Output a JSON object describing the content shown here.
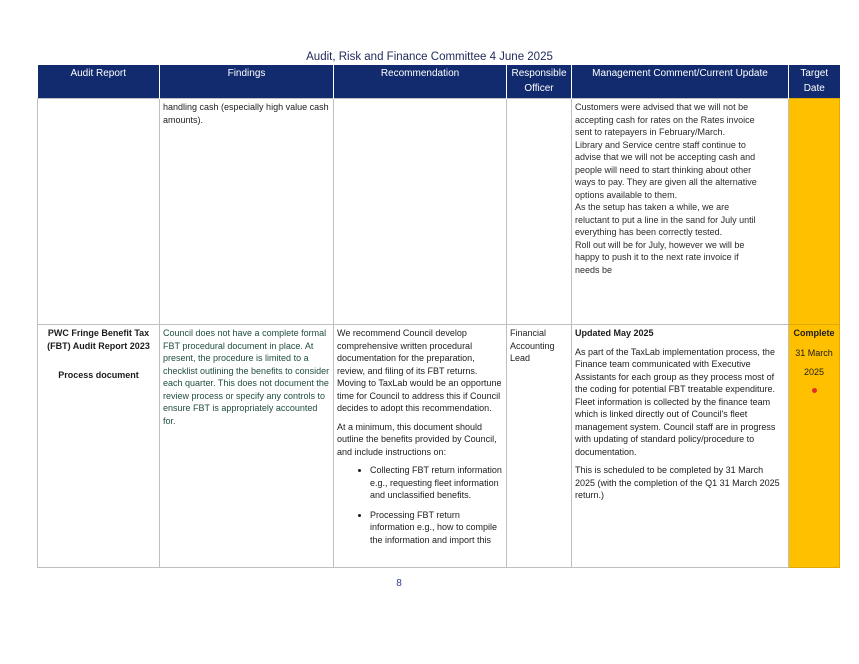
{
  "document": {
    "title": "Audit, Risk and Finance Committee 4 June 2025",
    "page_number": "8"
  },
  "table": {
    "headers": {
      "audit_report": "Audit Report",
      "findings": "Findings",
      "recommendation": "Recommendation",
      "responsible_officer": "Responsible Officer",
      "management_comment": "Management Comment/Current Update",
      "target_date": "Target Date"
    },
    "row1": {
      "findings": "handling cash (especially high value cash amounts).",
      "update_lines": [
        "Customers were advised that we will not be",
        "accepting cash for rates on the Rates invoice",
        "sent to ratepayers in February/March.",
        "Library and Service centre staff continue to",
        "advise that we will not be accepting cash and",
        "people will need to start thinking about other",
        "ways to pay. They are given all the alternative",
        "options available to them.",
        "As the setup has taken a while, we are",
        "reluctant to put a line in the sand for July until",
        "everything has been correctly tested.",
        "Roll out will be for July, however we will be",
        "happy to push it to the next rate invoice if",
        "needs be"
      ]
    },
    "row2": {
      "audit_title": "PWC Fringe Benefit Tax (FBT) Audit Report 2023",
      "audit_subtitle": "Process document",
      "findings": "Council does not have a complete formal FBT procedural document in place. At present, the procedure is limited to a checklist outlining the benefits to consider each quarter. This does not document the review process or specify any controls to ensure FBT is appropriately accounted for.",
      "recommendation_p1": "We recommend Council develop comprehensive written procedural documentation for the preparation, review, and filing of its FBT returns. Moving to TaxLab would be an opportune time for Council to address this if Council decides to adopt this recommendation.",
      "recommendation_p2": "At a minimum, this document should outline the benefits provided by Council, and include instructions on:",
      "recommendation_bullets": [
        "Collecting FBT return information e.g., requesting fleet information and unclassified benefits.",
        "Processing FBT return information e.g., how to compile the information and import this"
      ],
      "responsible_officer": "Financial Accounting Lead",
      "update_heading": "Updated May 2025",
      "update_p1": "As part of the TaxLab implementation process, the Finance team communicated with Executive Assistants for each group as they process most of the coding for potential FBT treatable expenditure. Fleet information is collected by the finance team which is linked directly out of Council's fleet management system. Council staff are in progress with updating of standard policy/procedure to documentation.",
      "update_p2": "This is scheduled to be completed by 31 March 2025 (with the completion of the Q1 31 March 2025 return.)",
      "target_status": "Complete",
      "target_date": "31 March",
      "target_year": "2025"
    }
  },
  "colors": {
    "header_bg": "#122b6e",
    "target_bg": "#ffc000",
    "status_dot": "#e32d2d"
  }
}
